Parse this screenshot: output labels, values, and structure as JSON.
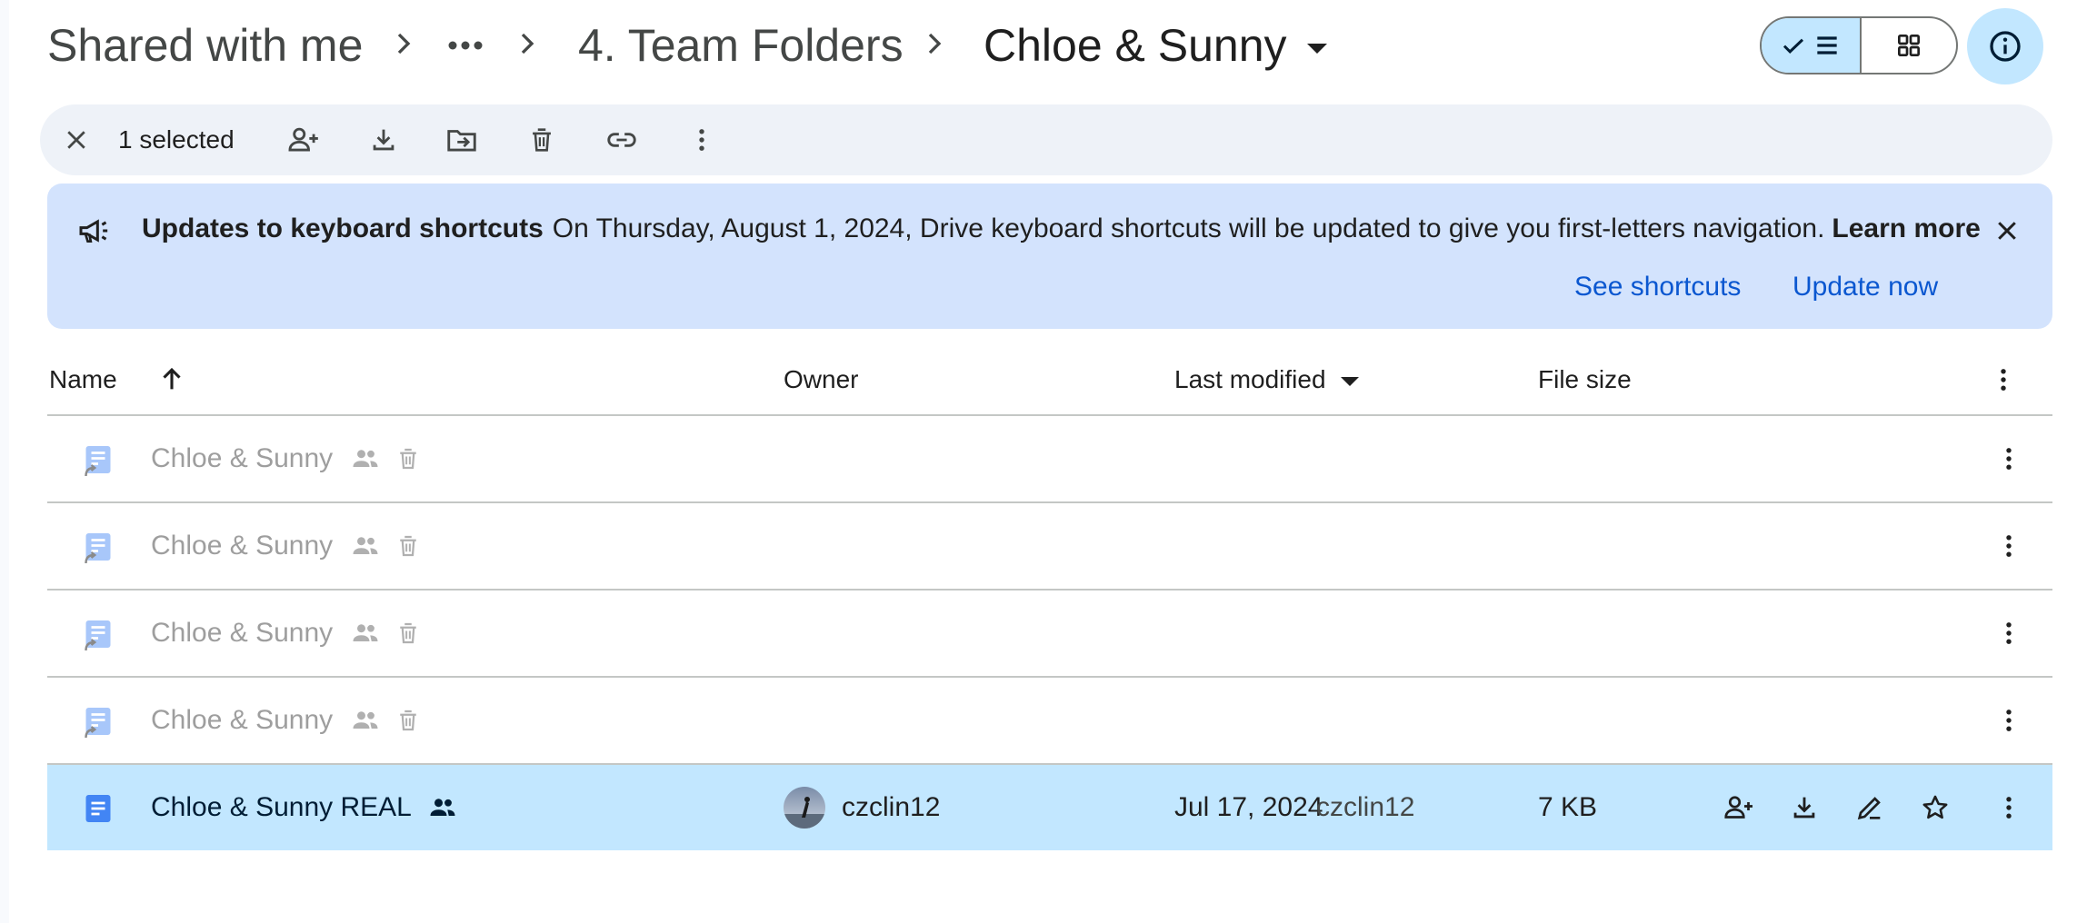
{
  "breadcrumb": {
    "root": "Shared with me",
    "ellipsis": "•••",
    "parent": "4. Team Folders",
    "current": "Chloe & Sunny"
  },
  "selection_toolbar": {
    "count_label": "1 selected"
  },
  "banner": {
    "title": "Updates to keyboard shortcuts",
    "message": "On Thursday, August 1, 2024, Drive keyboard shortcuts will be updated to give you first-letters navigation.",
    "learn_more": "Learn more",
    "see_shortcuts": "See shortcuts",
    "update_now": "Update now"
  },
  "table": {
    "headers": {
      "name": "Name",
      "owner": "Owner",
      "last_modified": "Last modified",
      "file_size": "File size"
    },
    "rows": [
      {
        "name": "Chloe & Sunny",
        "faded": true
      },
      {
        "name": "Chloe & Sunny",
        "faded": true
      },
      {
        "name": "Chloe & Sunny",
        "faded": true
      },
      {
        "name": "Chloe & Sunny",
        "faded": true
      },
      {
        "name": "Chloe & Sunny REAL",
        "owner": "czclin12",
        "modified_date": "Jul 17, 2024",
        "modified_by": "czclin12",
        "size": "7 KB",
        "selected": true
      }
    ]
  },
  "colors": {
    "accent": "#0b57d0",
    "selected_row": "#c2e7ff",
    "banner_bg": "#d3e3fd",
    "toolbar_bg": "#eef2f8",
    "doc_icon": "#4285f4"
  }
}
